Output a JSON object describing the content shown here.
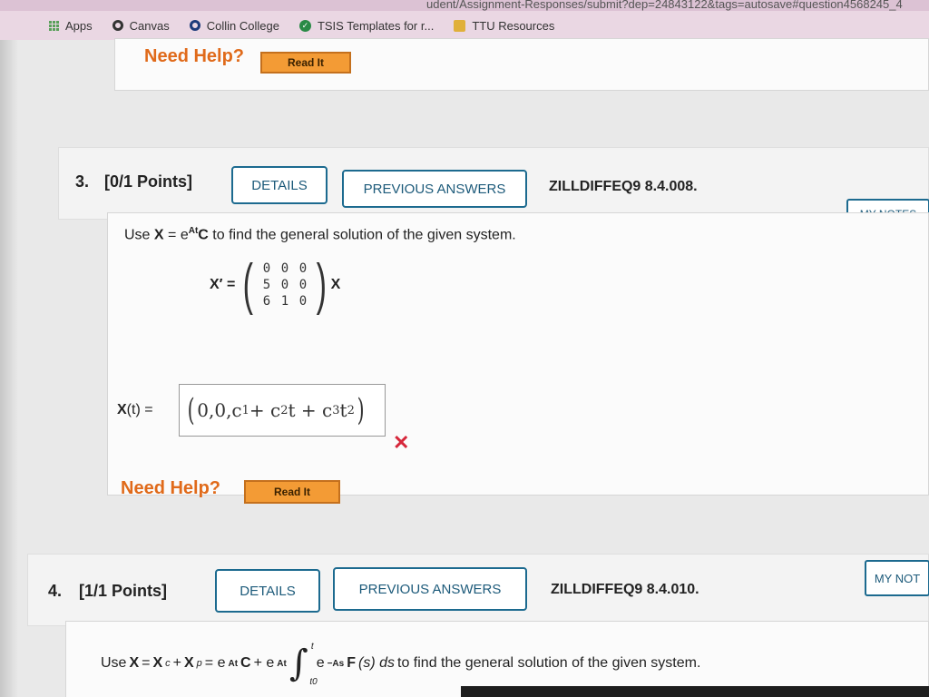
{
  "browser": {
    "url_fragment": "udent/Assignment-Responses/submit?dep=24843122&tags=autosave#question4568245_4",
    "bookmarks": [
      {
        "label": "Apps",
        "icon": "apps-grid-icon"
      },
      {
        "label": "Canvas",
        "icon": "canvas-icon"
      },
      {
        "label": "Collin College",
        "icon": "collin-college-icon"
      },
      {
        "label": "TSIS Templates for r...",
        "icon": "tsis-icon"
      },
      {
        "label": "TTU Resources",
        "icon": "folder-icon"
      }
    ]
  },
  "prev_question": {
    "need_help": "Need Help?",
    "read_it": "Read It"
  },
  "q3": {
    "number": "3.",
    "points": "[0/1 Points]",
    "details_btn": "DETAILS",
    "prev_answers_btn": "PREVIOUS ANSWERS",
    "code": "ZILLDIFFEQ9 8.4.008.",
    "my_notes_btn": "MY NOTES",
    "statement": {
      "pre": "Use ",
      "x_bold": "X",
      "eq": " = e",
      "exp": "At",
      "c_bold": "C",
      "post": " to find the general solution of the given system."
    },
    "system_lhs": "X′ =",
    "system_rhs": "X",
    "matrix": [
      [
        "0",
        "0",
        "0"
      ],
      [
        "5",
        "0",
        "0"
      ],
      [
        "6",
        "1",
        "0"
      ]
    ],
    "answer_label_x": "X",
    "answer_label_rest": "(t) =",
    "answer": {
      "c1": "0,0,c",
      "c1_sub": "1",
      "plus1": " + c",
      "c2_sub": "2",
      "t1": "t + c",
      "c3_sub": "3",
      "t2": "t",
      "t2_sup": "2"
    },
    "status_icon": "wrong-x-icon",
    "need_help": "Need Help?",
    "read_it": "Read It"
  },
  "q4": {
    "number": "4.",
    "points": "[1/1 Points]",
    "details_btn": "DETAILS",
    "prev_answers_btn": "PREVIOUS ANSWERS",
    "code": "ZILLDIFFEQ9 8.4.010.",
    "my_notes_btn": "MY NOT",
    "statement": {
      "pre": "Use ",
      "x": "X",
      "eq1": " = ",
      "xc": "X",
      "xc_sub": "c",
      "plus": " + ",
      "xp": "X",
      "xp_sub": "p",
      "eq2": " = e",
      "exp1": "At",
      "c": "C",
      "plus2": " + e",
      "exp2": "At",
      "integral_upper": "t",
      "integral_lower": "t0",
      "e": "e",
      "exp3": "−As",
      "f": "F",
      "fs": "(s) ds",
      "post": " to find the general solution of the given system."
    }
  },
  "colors": {
    "accent_blue": "#1c6a8f",
    "need_help_orange": "#e06a1a",
    "read_it_orange": "#f39b35",
    "wrong_red": "#d6263a"
  }
}
